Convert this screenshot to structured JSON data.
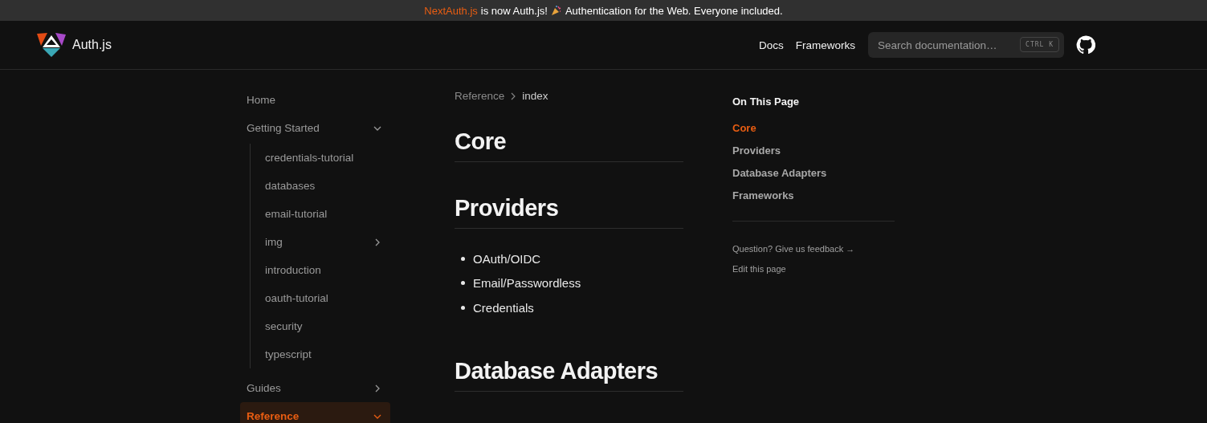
{
  "banner": {
    "link": "NextAuth.js",
    "text_before_icon": "is now Auth.js!",
    "text_after_icon": "Authentication for the Web. Everyone included."
  },
  "header": {
    "logo_text": "Auth.js",
    "nav": [
      {
        "label": "Docs"
      },
      {
        "label": "Frameworks"
      }
    ],
    "search": {
      "placeholder": "Search documentation…",
      "shortcut": "CTRL K"
    }
  },
  "sidebar": {
    "items": [
      {
        "label": "Home",
        "selected": false
      },
      {
        "label": "Getting Started",
        "selected": false,
        "expanded": true,
        "children": [
          {
            "label": "credentials-tutorial",
            "selected": false
          },
          {
            "label": "databases",
            "selected": false
          },
          {
            "label": "email-tutorial",
            "selected": false
          },
          {
            "label": "img",
            "selected": false,
            "expanded": false
          },
          {
            "label": "introduction",
            "selected": false
          },
          {
            "label": "oauth-tutorial",
            "selected": false
          },
          {
            "label": "security",
            "selected": false
          },
          {
            "label": "typescript",
            "selected": false
          }
        ]
      },
      {
        "label": "Guides",
        "selected": false,
        "expanded": false
      },
      {
        "label": "Reference",
        "selected": true,
        "expanded": true
      }
    ]
  },
  "breadcrumb": [
    "Reference",
    "index"
  ],
  "content": [
    {
      "kind": "heading",
      "text": "Core"
    },
    {
      "kind": "heading",
      "text": "Providers"
    },
    {
      "kind": "list",
      "items": [
        "OAuth/OIDC",
        "Email/Passwordless",
        "Credentials"
      ]
    },
    {
      "kind": "heading",
      "text": "Database Adapters"
    }
  ],
  "toc": {
    "title": "On This Page",
    "items": [
      {
        "label": "Core",
        "selected": true
      },
      {
        "label": "Providers",
        "selected": false
      },
      {
        "label": "Database Adapters",
        "selected": false
      },
      {
        "label": "Frameworks",
        "selected": false
      }
    ],
    "links": [
      "Question? Give us feedback →",
      "Edit this page"
    ]
  }
}
